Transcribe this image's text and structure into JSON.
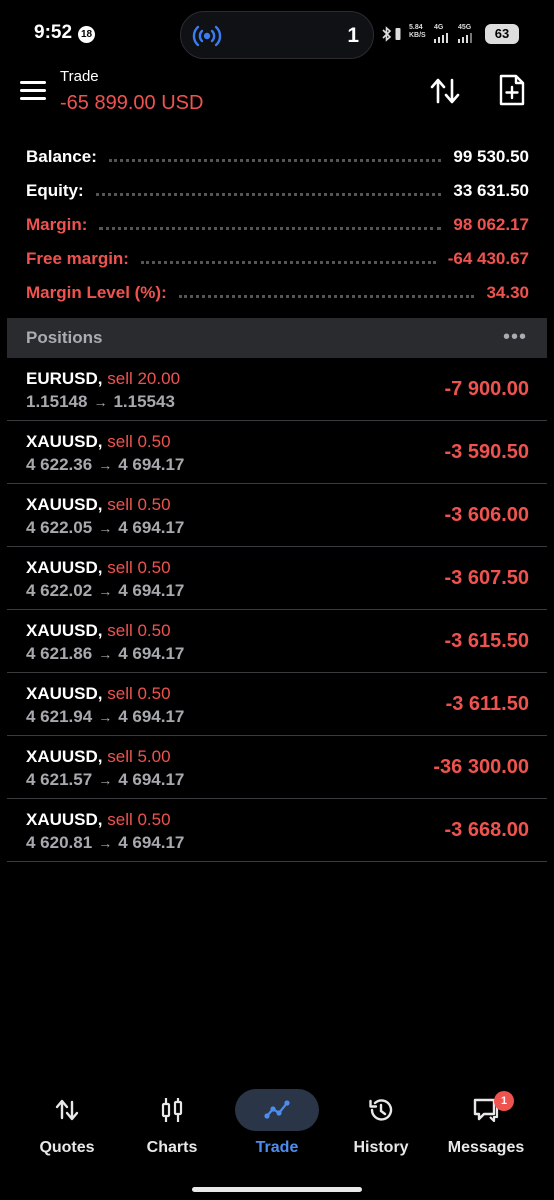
{
  "status_bar": {
    "time": "9:52",
    "notification_count": "18",
    "island_count": "1",
    "network_speed": "5.84 KB/S",
    "network_4g": "4G",
    "network_5g": "45G",
    "battery": "63"
  },
  "header": {
    "title": "Trade",
    "total_profit": "-65 899.00 USD"
  },
  "summary": [
    {
      "label": "Balance:",
      "value": "99 530.50",
      "color": "#ffffff"
    },
    {
      "label": "Equity:",
      "value": "33 631.50",
      "color": "#ffffff"
    },
    {
      "label": "Margin:",
      "value": "98 062.17",
      "color": "#ef5350"
    },
    {
      "label": "Free margin:",
      "value": "-64 430.67",
      "color": "#ef5350"
    },
    {
      "label": "Margin Level (%):",
      "value": "34.30",
      "color": "#ef5350"
    }
  ],
  "positions": {
    "title": "Positions",
    "more_icon": "ellipsis-icon",
    "arrow": "→",
    "items": [
      {
        "symbol": "EURUSD,",
        "side": "sell 20.00",
        "open_price": "1.15148",
        "current_price": "1.15543",
        "profit": "-7 900.00"
      },
      {
        "symbol": "XAUUSD,",
        "side": "sell 0.50",
        "open_price": "4 622.36",
        "current_price": "4 694.17",
        "profit": "-3 590.50"
      },
      {
        "symbol": "XAUUSD,",
        "side": "sell 0.50",
        "open_price": "4 622.05",
        "current_price": "4 694.17",
        "profit": "-3 606.00"
      },
      {
        "symbol": "XAUUSD,",
        "side": "sell 0.50",
        "open_price": "4 622.02",
        "current_price": "4 694.17",
        "profit": "-3 607.50"
      },
      {
        "symbol": "XAUUSD,",
        "side": "sell 0.50",
        "open_price": "4 621.86",
        "current_price": "4 694.17",
        "profit": "-3 615.50"
      },
      {
        "symbol": "XAUUSD,",
        "side": "sell 0.50",
        "open_price": "4 621.94",
        "current_price": "4 694.17",
        "profit": "-3 611.50"
      },
      {
        "symbol": "XAUUSD,",
        "side": "sell 5.00",
        "open_price": "4 621.57",
        "current_price": "4 694.17",
        "profit": "-36 300.00"
      },
      {
        "symbol": "XAUUSD,",
        "side": "sell 0.50",
        "open_price": "4 620.81",
        "current_price": "4 694.17",
        "profit": "-3 668.00"
      }
    ]
  },
  "bottom_nav": {
    "quotes": "Quotes",
    "charts": "Charts",
    "trade": "Trade",
    "history": "History",
    "messages": "Messages",
    "messages_badge": "1",
    "active": "Trade"
  },
  "colors": {
    "loss": "#ef5350",
    "accent": "#4d8df0",
    "background": "#000000",
    "section_header": "#2a2b2e"
  }
}
